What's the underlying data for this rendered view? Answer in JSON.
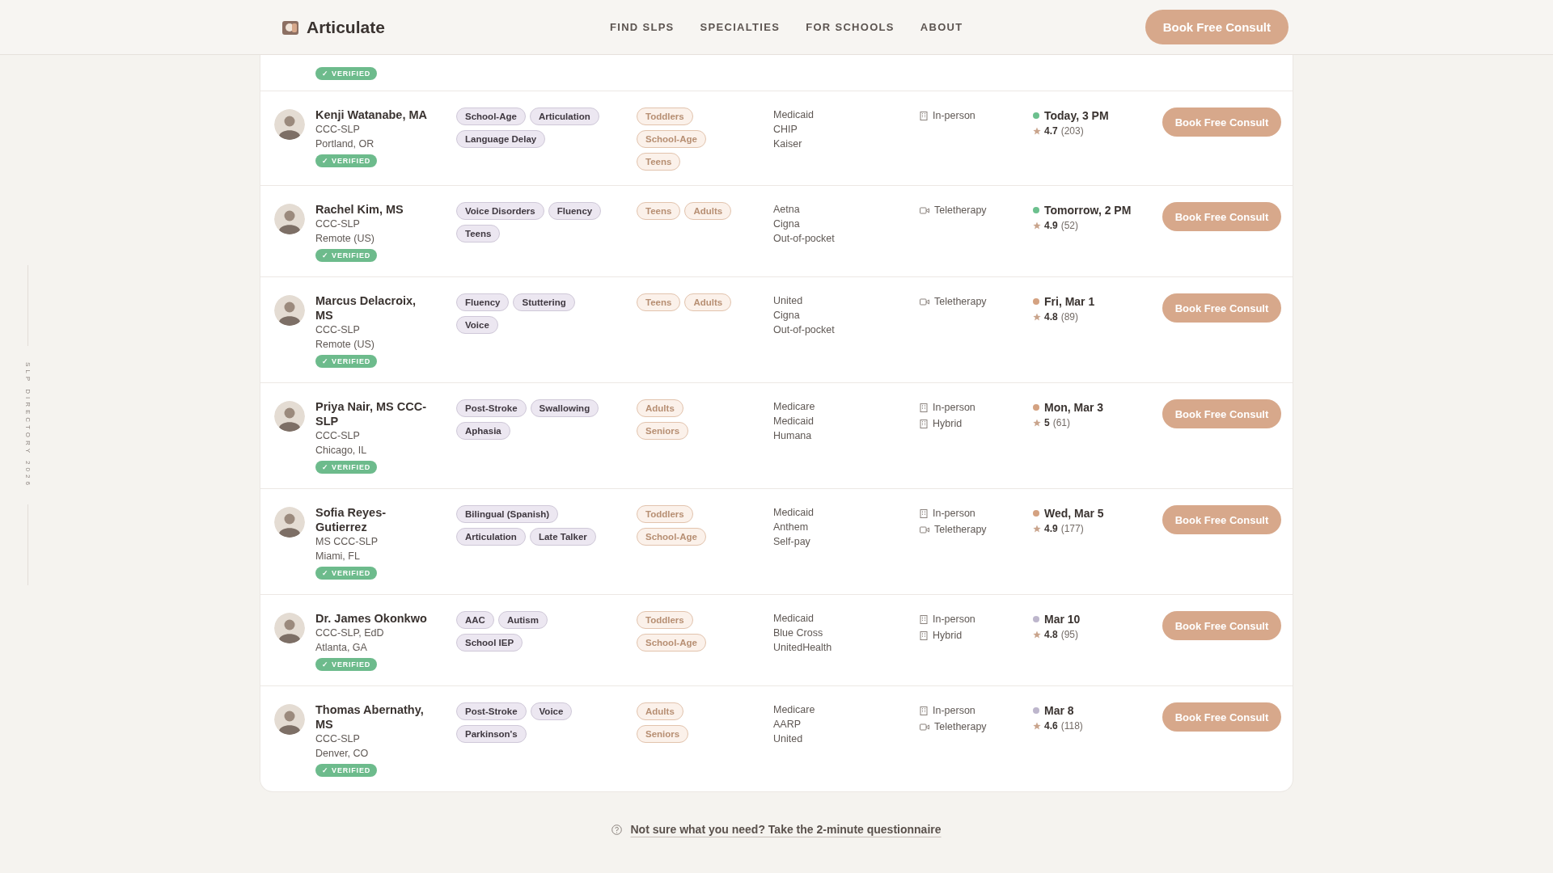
{
  "header": {
    "brand": "Articulate",
    "nav": [
      "FIND SLPS",
      "SPECIALTIES",
      "FOR SCHOOLS",
      "ABOUT"
    ],
    "cta": "Book Free Consult"
  },
  "side_rail": {
    "label": "SLP DIRECTORY 2026"
  },
  "partial_row": {
    "verified": "✓ VERIFIED"
  },
  "providers": [
    {
      "name": "Kenji Watanabe, MA",
      "credential": "CCC-SLP",
      "location": "Portland, OR",
      "verified": "✓ VERIFIED",
      "specialties": [
        "School-Age",
        "Articulation",
        "Language Delay"
      ],
      "ages": [
        "Toddlers",
        "School-Age",
        "Teens"
      ],
      "insurance": [
        "Medicaid",
        "CHIP",
        "Kaiser"
      ],
      "formats": [
        {
          "kind": "building",
          "label": "In-person"
        }
      ],
      "availability": {
        "label": "Today, 3 PM",
        "color": "#6cc08e"
      },
      "rating": "4.7",
      "reviews": "(203)",
      "button": "Book Free Consult"
    },
    {
      "name": "Rachel Kim, MS",
      "credential": "CCC-SLP",
      "location": "Remote (US)",
      "verified": "✓ VERIFIED",
      "specialties": [
        "Voice Disorders",
        "Fluency",
        "Teens"
      ],
      "ages": [
        "Teens",
        "Adults"
      ],
      "insurance": [
        "Aetna",
        "Cigna",
        "Out-of-pocket"
      ],
      "formats": [
        {
          "kind": "video",
          "label": "Teletherapy"
        }
      ],
      "availability": {
        "label": "Tomorrow, 2 PM",
        "color": "#6cc08e"
      },
      "rating": "4.9",
      "reviews": "(52)",
      "button": "Book Free Consult"
    },
    {
      "name": "Marcus Delacroix, MS",
      "credential": "CCC-SLP",
      "location": "Remote (US)",
      "verified": "✓ VERIFIED",
      "specialties": [
        "Fluency",
        "Stuttering",
        "Voice"
      ],
      "ages": [
        "Teens",
        "Adults"
      ],
      "insurance": [
        "United",
        "Cigna",
        "Out-of-pocket"
      ],
      "formats": [
        {
          "kind": "video",
          "label": "Teletherapy"
        }
      ],
      "availability": {
        "label": "Fri, Mar 1",
        "color": "#d4a281"
      },
      "rating": "4.8",
      "reviews": "(89)",
      "button": "Book Free Consult"
    },
    {
      "name": "Priya Nair, MS CCC-SLP",
      "credential": "CCC-SLP",
      "location": "Chicago, IL",
      "verified": "✓ VERIFIED",
      "specialties": [
        "Post-Stroke",
        "Swallowing",
        "Aphasia"
      ],
      "ages": [
        "Adults",
        "Seniors"
      ],
      "insurance": [
        "Medicare",
        "Medicaid",
        "Humana"
      ],
      "formats": [
        {
          "kind": "building",
          "label": "In-person"
        },
        {
          "kind": "building",
          "label": "Hybrid"
        }
      ],
      "availability": {
        "label": "Mon, Mar 3",
        "color": "#d4a281"
      },
      "rating": "5",
      "reviews": "(61)",
      "button": "Book Free Consult"
    },
    {
      "name": "Sofia Reyes-Gutierrez",
      "credential": "MS CCC-SLP",
      "location": "Miami, FL",
      "verified": "✓ VERIFIED",
      "specialties": [
        "Bilingual (Spanish)",
        "Articulation",
        "Late Talker"
      ],
      "ages": [
        "Toddlers",
        "School-Age"
      ],
      "insurance": [
        "Medicaid",
        "Anthem",
        "Self-pay"
      ],
      "formats": [
        {
          "kind": "building",
          "label": "In-person"
        },
        {
          "kind": "video",
          "label": "Teletherapy"
        }
      ],
      "availability": {
        "label": "Wed, Mar 5",
        "color": "#d4a281"
      },
      "rating": "4.9",
      "reviews": "(177)",
      "button": "Book Free Consult"
    },
    {
      "name": "Dr. James Okonkwo",
      "credential": "CCC-SLP, EdD",
      "location": "Atlanta, GA",
      "verified": "✓ VERIFIED",
      "specialties": [
        "AAC",
        "Autism",
        "School IEP"
      ],
      "ages": [
        "Toddlers",
        "School-Age"
      ],
      "insurance": [
        "Medicaid",
        "Blue Cross",
        "UnitedHealth"
      ],
      "formats": [
        {
          "kind": "building",
          "label": "In-person"
        },
        {
          "kind": "building",
          "label": "Hybrid"
        }
      ],
      "availability": {
        "label": "Mar 10",
        "color": "#bdb6cc"
      },
      "rating": "4.8",
      "reviews": "(95)",
      "button": "Book Free Consult"
    },
    {
      "name": "Thomas Abernathy, MS",
      "credential": "CCC-SLP",
      "location": "Denver, CO",
      "verified": "✓ VERIFIED",
      "specialties": [
        "Post-Stroke",
        "Voice",
        "Parkinson's"
      ],
      "ages": [
        "Adults",
        "Seniors"
      ],
      "insurance": [
        "Medicare",
        "AARP",
        "United"
      ],
      "formats": [
        {
          "kind": "building",
          "label": "In-person"
        },
        {
          "kind": "video",
          "label": "Teletherapy"
        }
      ],
      "availability": {
        "label": "Mar 8",
        "color": "#bdb6cc"
      },
      "rating": "4.6",
      "reviews": "(118)",
      "button": "Book Free Consult"
    }
  ],
  "footer_link": "Not sure what you need? Take the 2-minute questionnaire"
}
